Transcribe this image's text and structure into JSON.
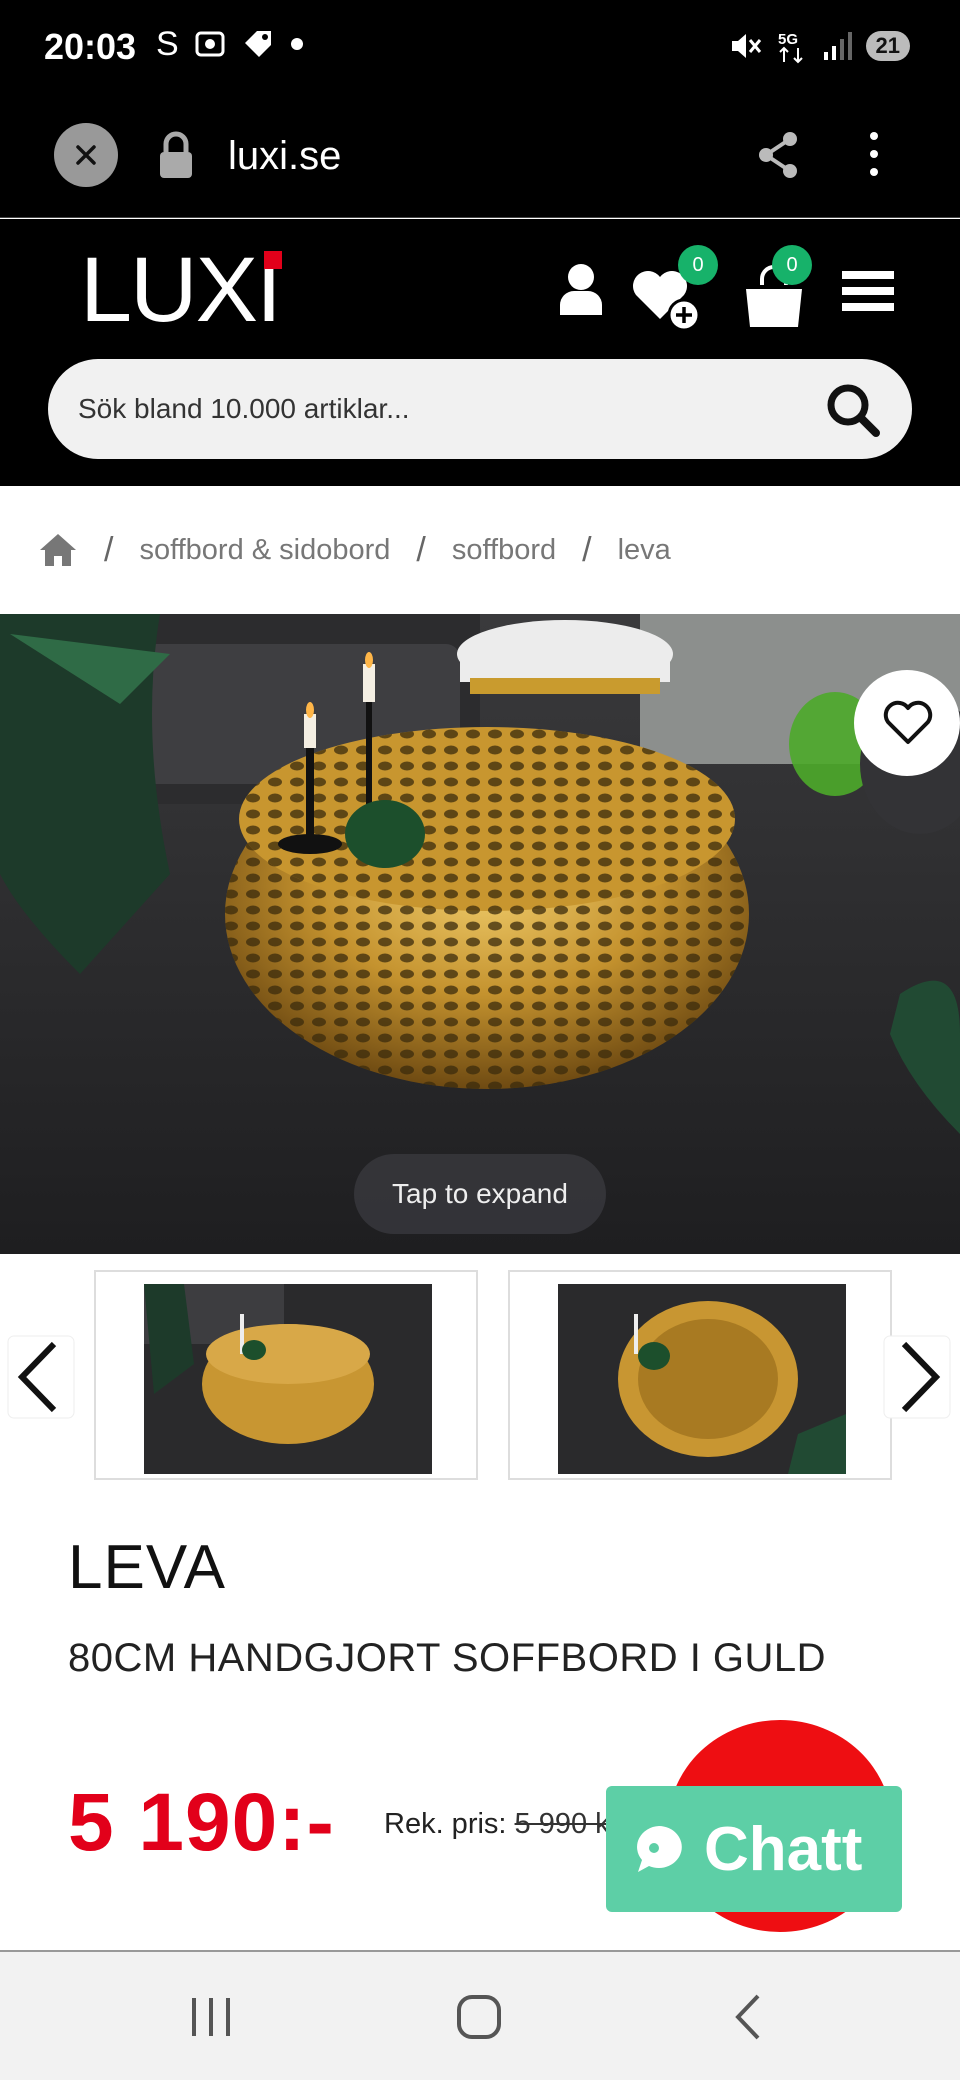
{
  "status_bar": {
    "time": "20:03",
    "left_icons": [
      "samsung-s-icon",
      "screenshot-icon",
      "tag-icon",
      "dot-icon"
    ],
    "right_icons": [
      "mute-icon",
      "5g-icon",
      "signal-icon"
    ],
    "battery": "21"
  },
  "browser": {
    "url": "luxi.se"
  },
  "header": {
    "logo": "LUXi",
    "wishlist_count": "0",
    "cart_count": "0",
    "search_placeholder": "Sök bland 10.000 artiklar..."
  },
  "breadcrumb": {
    "items": [
      "soffbord & sidobord",
      "soffbord",
      "leva"
    ],
    "separator": "/"
  },
  "gallery": {
    "tap_label": "Tap to expand"
  },
  "product": {
    "brand": "LEVA",
    "title": "80CM HANDGJORT SOFFBORD I GULD",
    "price": "5 190:-",
    "rek_label": "Rek. pris:",
    "rek_price": "5 990 kr"
  },
  "chat": {
    "label": "Chatt"
  },
  "colors": {
    "accent_red": "#e2001a",
    "badge_green": "#17b26a",
    "chat_green": "#5dcfa6"
  }
}
